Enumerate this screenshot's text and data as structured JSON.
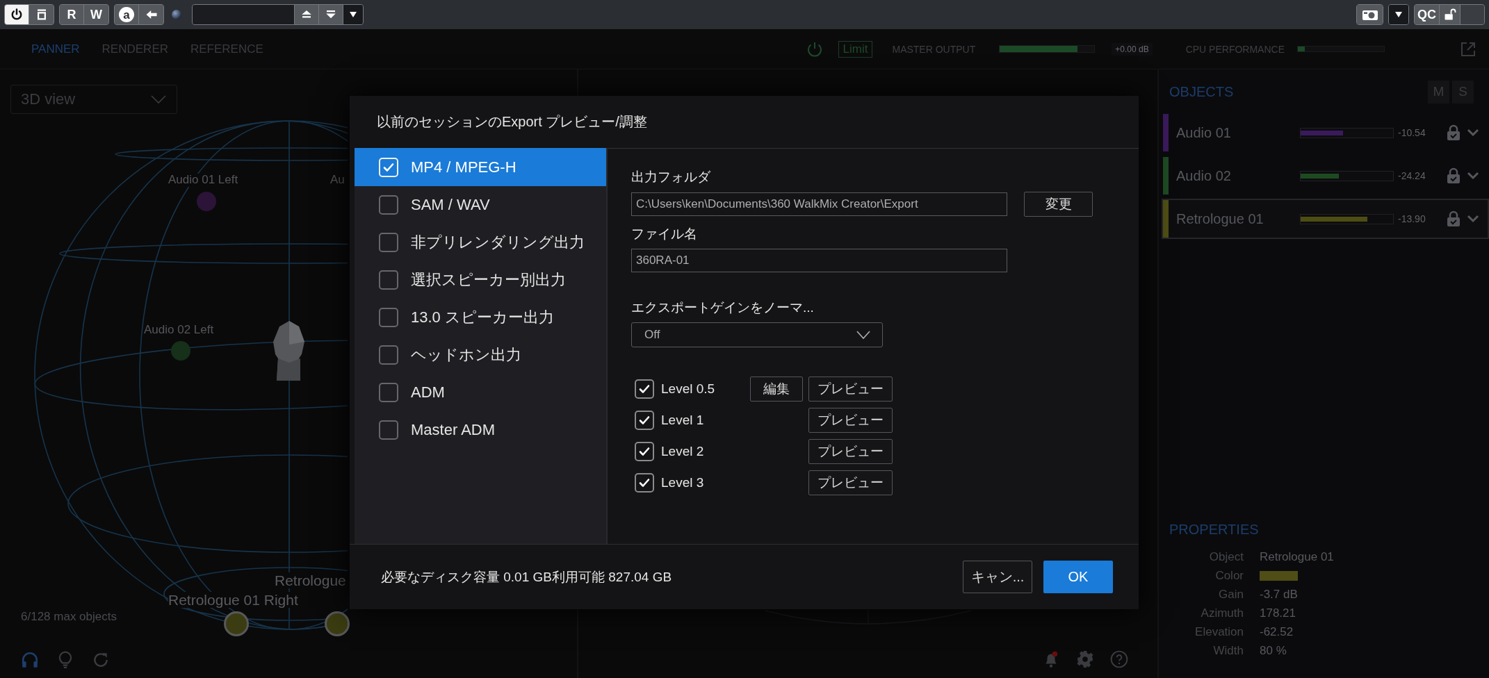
{
  "toolbar": {
    "left_groups": [
      {
        "items": [
          {
            "kind": "power",
            "on": true
          },
          {
            "kind": "square",
            "on": false
          }
        ]
      },
      {
        "items": [
          {
            "kind": "text",
            "label": "R"
          },
          {
            "kind": "text",
            "label": "W"
          }
        ]
      },
      {
        "items": [
          {
            "kind": "circled",
            "label": "a"
          },
          {
            "kind": "back"
          }
        ]
      },
      {
        "items": [
          {
            "kind": "orb"
          }
        ]
      },
      {
        "items": [
          {
            "kind": "field"
          },
          {
            "kind": "up"
          },
          {
            "kind": "down"
          },
          {
            "kind": "caret"
          }
        ]
      }
    ],
    "right_groups": [
      {
        "items": [
          {
            "kind": "camera"
          }
        ]
      },
      {
        "items": [
          {
            "kind": "caret"
          }
        ]
      },
      {
        "items": [
          {
            "kind": "text",
            "label": "QC"
          },
          {
            "kind": "lock"
          },
          {
            "kind": "blank"
          }
        ]
      }
    ]
  },
  "nav": {
    "tabs": [
      {
        "label": "PANNER",
        "selected": true
      },
      {
        "label": "RENDERER",
        "selected": false
      },
      {
        "label": "REFERENCE",
        "selected": false
      }
    ],
    "limit": {
      "label": "Limit"
    },
    "master_output": {
      "label": "MASTER OUTPUT",
      "level": 0.82,
      "reading": "+0.00 dB"
    },
    "cpu_performance": {
      "label": "CPU PERFORMANCE",
      "level": 0.08
    }
  },
  "panner": {
    "view_select": {
      "value": "3D view"
    },
    "markers": [
      {
        "label": "Audio 01 Left",
        "color": "#2c1438"
      },
      {
        "label": "Au"
      },
      {
        "label": "Audio 02 Left",
        "color": "#16301a"
      },
      {
        "label": "Retrologue 01 Right",
        "color": "#3c3c12"
      },
      {
        "label": "Retrologue",
        "color": "#3c3c12"
      }
    ],
    "object_count": "6/128 max objects"
  },
  "objects_panel": {
    "title": "OBJECTS",
    "buttons": [
      "M",
      "S"
    ],
    "rows": [
      {
        "name": "Audio 01",
        "color": "#3a1a5c",
        "level": 0.46,
        "reading": "-10.54",
        "selected": false
      },
      {
        "name": "Audio 02",
        "color": "#1e4a22",
        "level": 0.41,
        "reading": "-24.24",
        "selected": false
      },
      {
        "name": "Retrologue 01",
        "color": "#4e4e14",
        "level": 0.72,
        "reading": "-13.90",
        "selected": true
      }
    ],
    "properties": {
      "title": "PROPERTIES",
      "rows": [
        {
          "label": "Object",
          "kind": "text",
          "value": "Retrologue 01"
        },
        {
          "label": "Color",
          "kind": "swatch",
          "color": "#4e4e16"
        },
        {
          "label": "Gain",
          "kind": "text",
          "value": "-3.7 dB"
        },
        {
          "label": "Azimuth",
          "kind": "text",
          "value": "178.21"
        },
        {
          "label": "Elevation",
          "kind": "text",
          "value": "-62.52"
        },
        {
          "label": "Width",
          "kind": "text",
          "value": "80 %"
        }
      ]
    }
  },
  "dialog": {
    "title": "以前のセッションのExport プレビュー/調整",
    "formats": [
      {
        "label": "MP4 / MPEG-H",
        "checked": true,
        "selected": true
      },
      {
        "label": "SAM / WAV",
        "checked": false,
        "selected": false
      },
      {
        "label": "非プリレンダリング出力",
        "checked": false,
        "selected": false
      },
      {
        "label": "選択スピーカー別出力",
        "checked": false,
        "selected": false
      },
      {
        "label": "13.0 スピーカー出力",
        "checked": false,
        "selected": false
      },
      {
        "label": "ヘッドホン出力",
        "checked": false,
        "selected": false
      },
      {
        "label": "ADM",
        "checked": false,
        "selected": false
      },
      {
        "label": "Master ADM",
        "checked": false,
        "selected": false
      }
    ],
    "output_folder": {
      "label": "出力フォルダ",
      "value": "C:\\Users\\ken\\Documents\\360 WalkMix Creator\\Export"
    },
    "change_button": "変更",
    "file_name": {
      "label": "ファイル名",
      "value": "360RA-01"
    },
    "gain_normalize": {
      "label": "エクスポートゲインをノーマ...",
      "value": "Off"
    },
    "levels": [
      {
        "label": "Level 0.5",
        "checked": true,
        "edit": "編集",
        "preview": "プレビュー"
      },
      {
        "label": "Level 1",
        "checked": true,
        "preview": "プレビュー"
      },
      {
        "label": "Level 2",
        "checked": true,
        "preview": "プレビュー"
      },
      {
        "label": "Level 3",
        "checked": true,
        "preview": "プレビュー"
      }
    ],
    "disk_info": "必要なディスク容量 0.01 GB利用可能 827.04 GB",
    "buttons": [
      {
        "label": "キャン...",
        "kind": "secondary"
      },
      {
        "label": "OK",
        "kind": "primary"
      }
    ]
  }
}
